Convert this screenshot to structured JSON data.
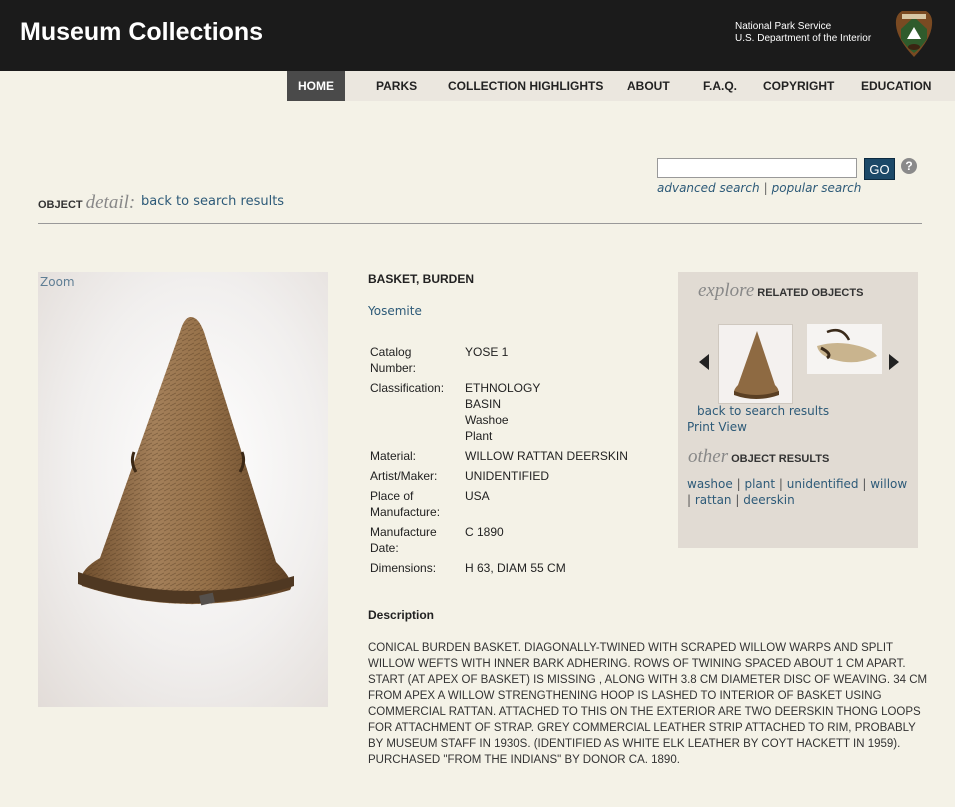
{
  "header": {
    "site_title": "Museum Collections",
    "agency_line1": "National Park Service",
    "agency_line2": "U.S. Department of the Interior",
    "logo_icon": "nps-arrowhead-icon"
  },
  "nav": {
    "items": [
      {
        "label": "HOME",
        "active": true
      },
      {
        "label": "PARKS"
      },
      {
        "label": "COLLECTION HIGHLIGHTS"
      },
      {
        "label": "ABOUT"
      },
      {
        "label": "F.A.Q."
      },
      {
        "label": "COPYRIGHT"
      },
      {
        "label": "EDUCATION"
      }
    ]
  },
  "search": {
    "value": "",
    "go_label": "GO",
    "help_label": "?",
    "advanced_link": "advanced search",
    "separator": "|",
    "popular_link": "popular search"
  },
  "page": {
    "object_label": "OBJECT",
    "detail_label": "detail:",
    "back_link": "back to search results"
  },
  "image": {
    "zoom_label": "Zoom"
  },
  "object": {
    "title": "BASKET, BURDEN",
    "park": "Yosemite",
    "fields": [
      {
        "label": "Catalog Number:",
        "values": [
          "YOSE 1"
        ]
      },
      {
        "label": "Classification:",
        "values": [
          "ETHNOLOGY",
          "BASIN",
          "Washoe",
          "Plant"
        ]
      },
      {
        "label": "Material:",
        "values": [
          "WILLOW RATTAN DEERSKIN"
        ]
      },
      {
        "label": "Artist/Maker:",
        "values": [
          "UNIDENTIFIED"
        ]
      },
      {
        "label": "Place of Manufacture:",
        "values": [
          "USA"
        ]
      },
      {
        "label": "Manufacture Date:",
        "values": [
          "C 1890"
        ]
      },
      {
        "label": "Dimensions:",
        "values": [
          "H 63, DIAM 55 CM"
        ]
      }
    ],
    "description_title": "Description",
    "description": "CONICAL BURDEN BASKET. DIAGONALLY-TWINED WITH SCRAPED WILLOW WARPS AND SPLIT WILLOW WEFTS WITH INNER BARK ADHERING. ROWS OF TWINING SPACED ABOUT 1 CM APART. START (AT APEX OF BASKET) IS MISSING , ALONG WITH 3.8 CM DIAMETER DISC OF WEAVING. 34 CM FROM APEX A WILLOW STRENGTHENING HOOP IS LASHED TO INTERIOR OF BASKET USING COMMERCIAL RATTAN. ATTACHED TO THIS ON THE EXTERIOR ARE TWO DEERSKIN THONG LOOPS FOR ATTACHMENT OF STRAP. GREY COMMERCIAL LEATHER STRIP ATTACHED TO RIM, PROBABLY BY MUSEUM STAFF IN 1930S. (IDENTIFIED AS WHITE ELK LEATHER BY COYT HACKETT IN 1959). PURCHASED \"FROM THE INDIANS\" BY DONOR CA. 1890."
  },
  "explore": {
    "italic": "explore",
    "caps": "RELATED OBJECTS",
    "back_link": "back to search results",
    "print_link": "Print View",
    "other_italic": "other",
    "other_caps": "OBJECT RESULTS",
    "tags": [
      "washoe",
      "plant",
      "unidentified",
      "willow",
      "rattan",
      "deerskin"
    ],
    "tag_separator": "|"
  }
}
